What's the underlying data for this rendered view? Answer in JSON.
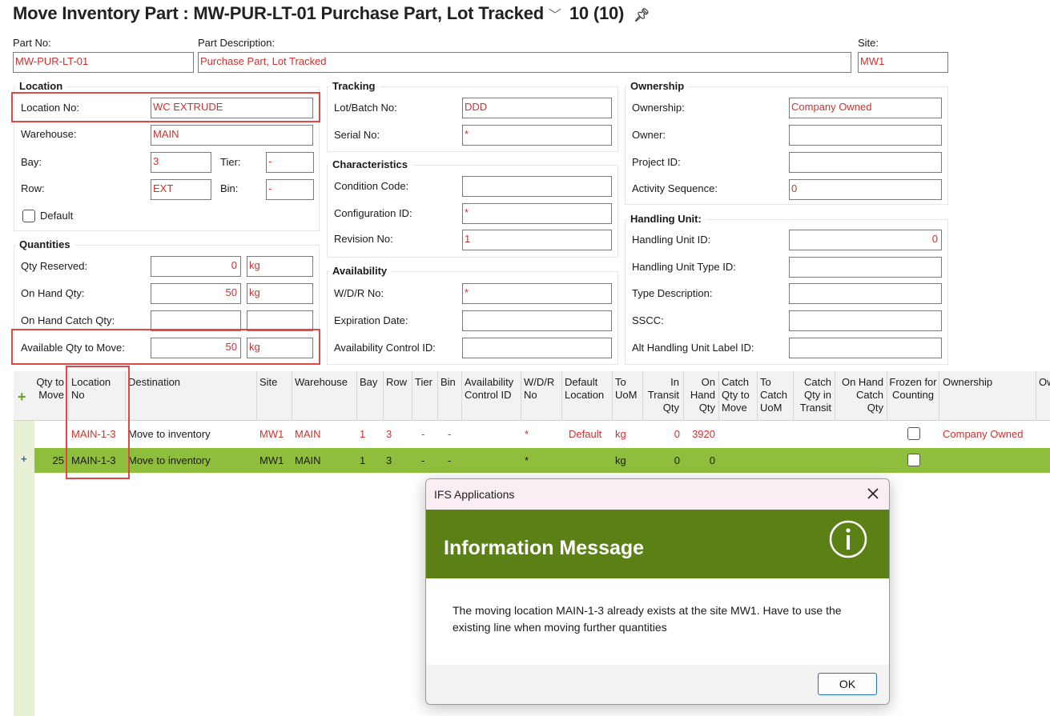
{
  "header": {
    "title": "Move Inventory Part : MW-PUR-LT-01  Purchase Part, Lot Tracked",
    "count": "10 (10)"
  },
  "part": {
    "part_no_label": "Part No:",
    "part_no": "MW-PUR-LT-01",
    "desc_label": "Part Description:",
    "desc": "Purchase Part, Lot Tracked",
    "site_label": "Site:",
    "site": "MW1"
  },
  "location": {
    "title": "Location",
    "location_no_label": "Location No:",
    "location_no": "WC EXTRUDE",
    "warehouse_label": "Warehouse:",
    "warehouse": "MAIN",
    "bay_label": "Bay:",
    "bay": "3",
    "tier_label": "Tier:",
    "tier": "-",
    "row_label": "Row:",
    "row": "EXT",
    "bin_label": "Bin:",
    "bin": "-",
    "default_label": "Default"
  },
  "quantities": {
    "title": "Quantities",
    "reserved_label": "Qty Reserved:",
    "reserved": "0",
    "reserved_uom": "kg",
    "onhand_label": "On Hand Qty:",
    "onhand": "50",
    "onhand_uom": "kg",
    "catch_label": "On Hand Catch Qty:",
    "available_label": "Available Qty to Move:",
    "available": "50",
    "available_uom": "kg"
  },
  "tracking": {
    "title": "Tracking",
    "lot_label": "Lot/Batch No:",
    "lot": "DDD",
    "serial_label": "Serial No:",
    "serial": "*"
  },
  "characteristics": {
    "title": "Characteristics",
    "condition_label": "Condition Code:",
    "config_label": "Configuration ID:",
    "config": "*",
    "revision_label": "Revision No:",
    "revision": "1"
  },
  "availability": {
    "title": "Availability",
    "wdr_label": "W/D/R No:",
    "wdr": "*",
    "expiration_label": "Expiration Date:",
    "control_label": "Availability Control ID:"
  },
  "ownership": {
    "title": "Ownership",
    "ownership_label": "Ownership:",
    "ownership": "Company Owned",
    "owner_label": "Owner:",
    "project_label": "Project ID:",
    "activity_label": "Activity Sequence:",
    "activity": "0"
  },
  "handling": {
    "title": "Handling Unit:",
    "hu_id_label": "Handling Unit ID:",
    "hu_id": "0",
    "hu_type_label": "Handling Unit Type ID:",
    "type_desc_label": "Type Description:",
    "sscc_label": "SSCC:",
    "alt_label": "Alt Handling Unit Label ID:"
  },
  "grid": {
    "columns": {
      "qty_to_move": "Qty to Move",
      "location_no": "Location No",
      "destination": "Destination",
      "site": "Site",
      "warehouse": "Warehouse",
      "bay": "Bay",
      "row": "Row",
      "tier": "Tier",
      "bin": "Bin",
      "avail_ctrl": "Availability Control ID",
      "wdr": "W/D/R No",
      "default_loc": "Default Location",
      "to_uom": "To UoM",
      "in_transit": "In Transit Qty",
      "on_hand": "On Hand Qty",
      "catch_move": "Catch Qty to Move",
      "to_catch_uom": "To Catch UoM",
      "catch_transit": "Catch Qty in Transit",
      "onhand_catch": "On Hand Catch Qty",
      "frozen": "Frozen for Counting",
      "ownership": "Ownership",
      "ow_cut": "Ow"
    },
    "rows": [
      {
        "qty": "",
        "location": "MAIN-1-3",
        "destination": "Move to inventory",
        "site": "MW1",
        "warehouse": "MAIN",
        "bay": "1",
        "row": "3",
        "tier": "-",
        "bin": "-",
        "wdr": "*",
        "default_loc": "Default",
        "uom": "kg",
        "in_transit": "0",
        "on_hand": "3920",
        "ownership": "Company Owned"
      },
      {
        "qty": "25",
        "location": "MAIN-1-3",
        "destination": "Move to inventory",
        "site": "MW1",
        "warehouse": "MAIN",
        "bay": "1",
        "row": "3",
        "tier": "-",
        "bin": "-",
        "wdr": "*",
        "default_loc": "",
        "uom": "kg",
        "in_transit": "0",
        "on_hand": "0",
        "ownership": ""
      }
    ]
  },
  "dialog": {
    "window_title": "IFS Applications",
    "heading": "Information Message",
    "message": "The moving location MAIN-1-3 already exists at the site MW1. Have to use the existing line when moving further quantities",
    "ok_label": "OK"
  },
  "colors": {
    "accent_red": "#d0312d",
    "highlight_green": "#8fbd3c",
    "banner_green": "#5a8016"
  }
}
